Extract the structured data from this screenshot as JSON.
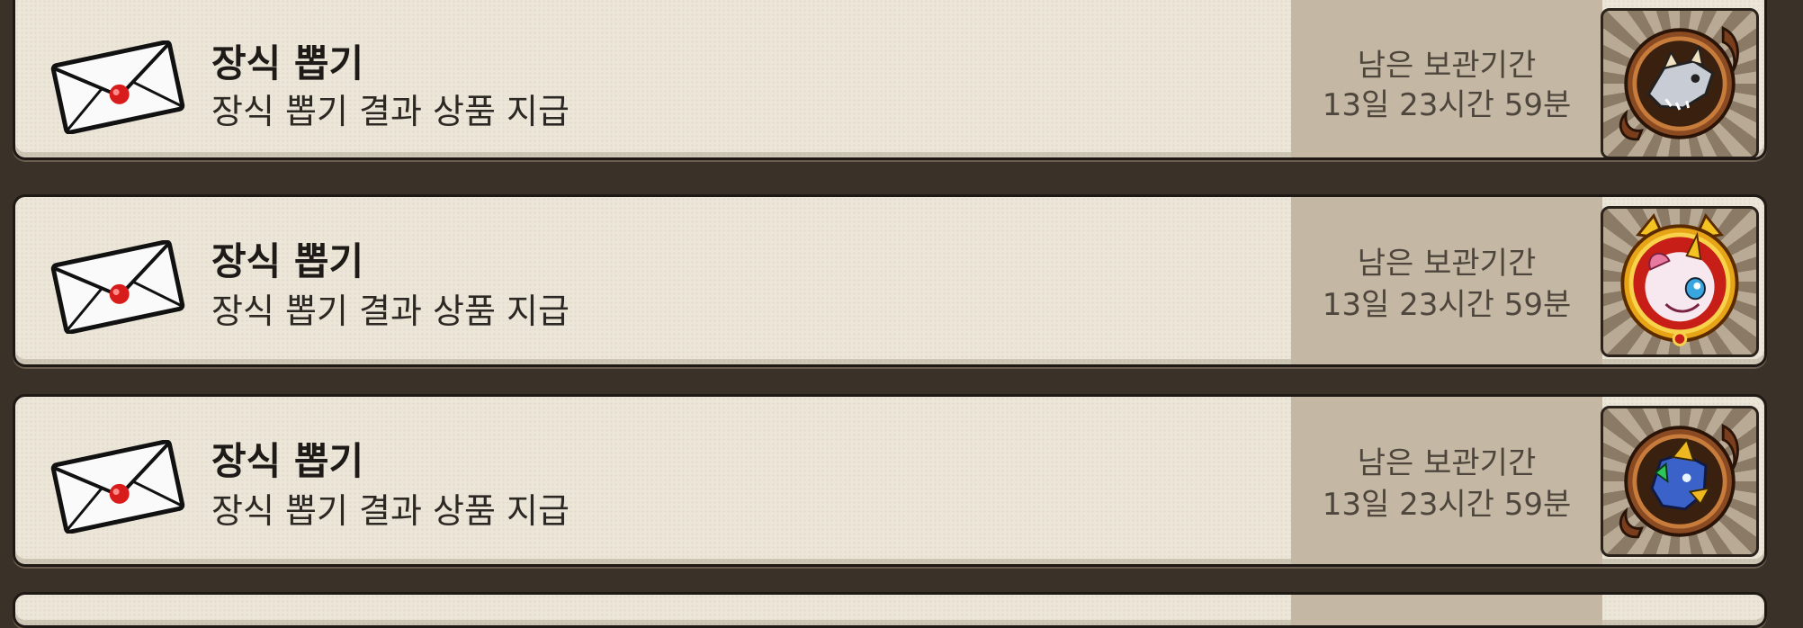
{
  "mails": [
    {
      "title": "장식 뽑기",
      "description": "장식 뽑기 결과 상품 지급",
      "expiry_label": "남은 보관기간",
      "expiry_time": "13일 23시간 59분",
      "reward_icon": "bronze-dragon-emblem-icon"
    },
    {
      "title": "장식 뽑기",
      "description": "장식 뽑기 결과 상품 지급",
      "expiry_label": "남은 보관기간",
      "expiry_time": "13일 23시간 59분",
      "reward_icon": "golden-pink-dragon-emblem-icon"
    },
    {
      "title": "장식 뽑기",
      "description": "장식 뽑기 결과 상품 지급",
      "expiry_label": "남은 보관기간",
      "expiry_time": "13일 23시간 59분",
      "reward_icon": "bronze-blue-dragon-emblem-icon"
    }
  ],
  "colors": {
    "card_bg": "#ece6d9",
    "expiry_panel": "#c4b8a4",
    "frame": "#1e1914",
    "seal_red": "#d81c1c"
  }
}
